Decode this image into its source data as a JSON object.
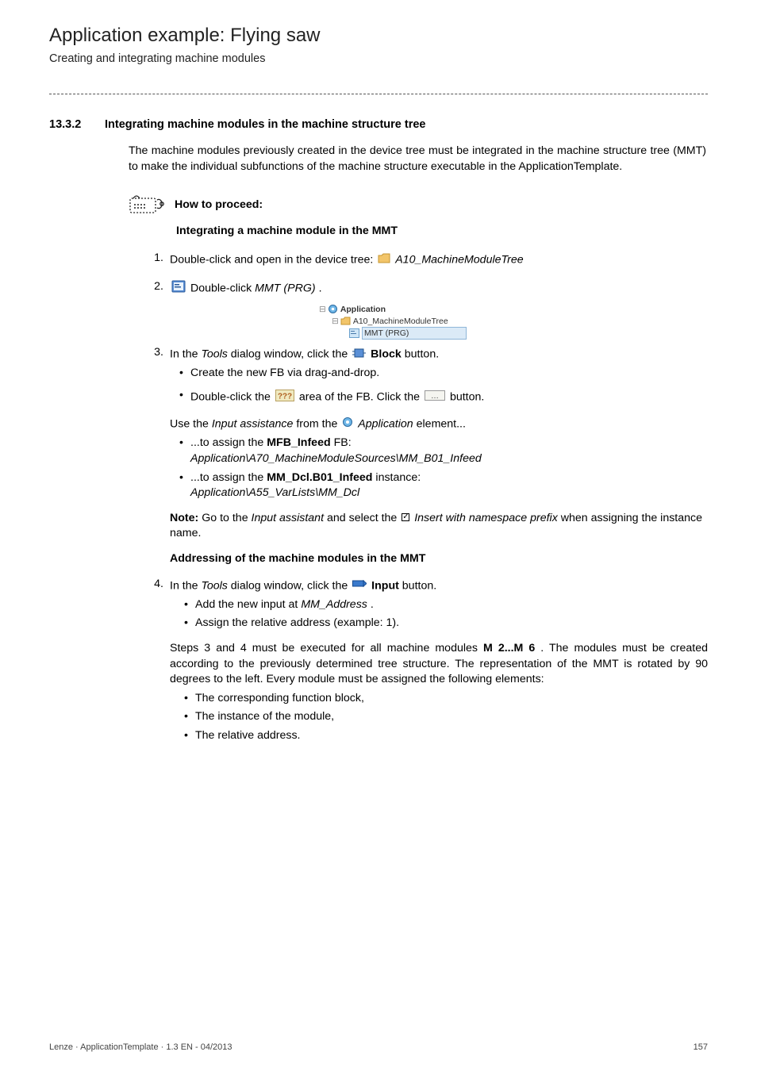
{
  "header": {
    "title": "Application example: Flying saw",
    "subtitle": "Creating and integrating machine modules"
  },
  "section": {
    "number": "13.3.2",
    "title": "Integrating machine modules in the machine structure tree",
    "intro": "The machine modules previously created in the device tree must be integrated in the machine structure tree (MMT) to make the individual subfunctions of the machine structure executable in the ApplicationTemplate."
  },
  "proceed": {
    "label": "How to proceed:",
    "subhead1": "Integrating a machine module in the MMT"
  },
  "steps": {
    "s1_num": "1.",
    "s1_a": "Double-click and open in the device tree: ",
    "s1_b": "A10_MachineModuleTree",
    "s2_num": "2.",
    "s2_a": "Double-click ",
    "s2_b": "MMT (PRG)",
    "s2_c": ".",
    "tree": {
      "app": "Application",
      "folder": "A10_MachineModuleTree",
      "leaf": "MMT (PRG)"
    },
    "s3_num": "3.",
    "s3_a": "In the ",
    "s3_b": "Tools",
    "s3_c": " dialog window, click the ",
    "s3_d": "Block",
    "s3_e": " button.",
    "s3_sub1": "Create the new FB via drag-and-drop.",
    "s3_sub2_a": "Double-click the ",
    "s3_sub2_b": " area of the FB. Click the ",
    "s3_sub2_c": " button.",
    "s3_p_a": "Use the ",
    "s3_p_b": "Input assistance",
    "s3_p_c": " from the ",
    "s3_p_d": "Application",
    "s3_p_e": " element...",
    "s3_sub3_a": "...to assign the ",
    "s3_sub3_b": "MFB_Infeed",
    "s3_sub3_c": " FB:",
    "s3_sub3_d": "Application\\A70_MachineModuleSources\\MM_B01_Infeed",
    "s3_sub4_a": "...to assign the ",
    "s3_sub4_b": "MM_Dcl.B01_Infeed",
    "s3_sub4_c": " instance:",
    "s3_sub4_d": "Application\\A55_VarLists\\MM_Dcl",
    "note_a": "Note:",
    "note_b": " Go to the ",
    "note_c": "Input assistant",
    "note_d": " and select the ",
    "note_e": "Insert with namespace prefix",
    "note_f": " when assigning the instance name.",
    "subhead2": "Addressing of the machine modules in the MMT",
    "s4_num": "4.",
    "s4_a": "In the ",
    "s4_b": "Tools",
    "s4_c": " dialog window, click the ",
    "s4_d": "Input",
    "s4_e": " button.",
    "s4_sub1_a": "Add the new input at ",
    "s4_sub1_b": "MM_Address",
    "s4_sub1_c": ".",
    "s4_sub2": "Assign the relative address (example: 1).",
    "s4_p_a": "Steps 3 and 4 must be executed for all machine modules ",
    "s4_p_b": "M 2...M 6",
    "s4_p_c": ". The modules must be created according to the previously determined tree structure. The representation of the MMT is rotated by 90 degrees to the left. Every module must be assigned the following elements:",
    "s4_sub3": "The corresponding function block,",
    "s4_sub4": "The instance of the module,",
    "s4_sub5": "The relative address."
  },
  "footer": {
    "left": "Lenze · ApplicationTemplate · 1.3 EN - 04/2013",
    "right": "157"
  }
}
